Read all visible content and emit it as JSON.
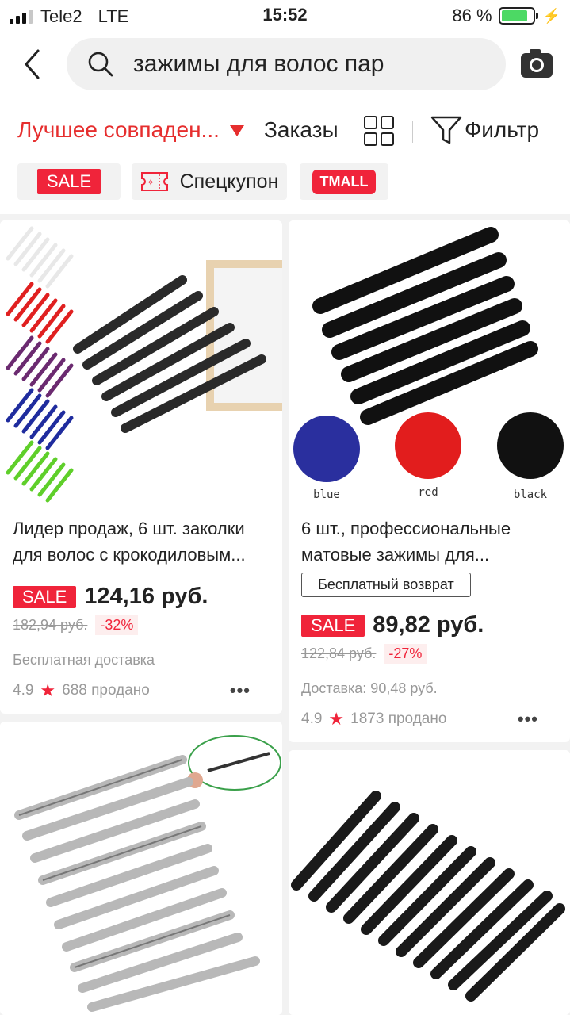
{
  "status_bar": {
    "carrier": "Tele2",
    "network": "LTE",
    "time": "15:52",
    "battery_percent": "86 %",
    "battery_level": 0.86,
    "signal_bars_active": 3,
    "signal_bars_total": 4
  },
  "header": {
    "search_query": "зажимы для волос пар"
  },
  "sort_bar": {
    "best_match_label": "Лучшее совпаден...",
    "orders_label": "Заказы",
    "filter_label": "Фильтр",
    "accent_color": "#e62e2e"
  },
  "chips": {
    "sale_label": "SALE",
    "coupon_label": "Спецкупон",
    "tmall_label": "TMALL"
  },
  "products": [
    {
      "title": "Лидер продаж, 6 шт. заколки для волос с крокодиловым...",
      "sale_label": "SALE",
      "price": "124,16 руб.",
      "old_price": "182,94 руб.",
      "discount": "-32%",
      "shipping": "Бесплатная доставка",
      "rating": "4.9",
      "sold": "688 продано",
      "more": "•••"
    },
    {
      "title": "6 шт., профессиональные матовые зажимы для...",
      "return_badge": "Бесплатный возврат",
      "sale_label": "SALE",
      "price": "89,82 руб.",
      "old_price": "122,84 руб.",
      "discount": "-27%",
      "shipping": "Доставка: 90,48 руб.",
      "rating": "4.9",
      "sold": "1873 продано",
      "more": "•••",
      "color_labels": [
        "blue",
        "red",
        "black"
      ]
    }
  ],
  "colors": {
    "sale_red": "#f0243a",
    "battery_green": "#4cd964"
  }
}
